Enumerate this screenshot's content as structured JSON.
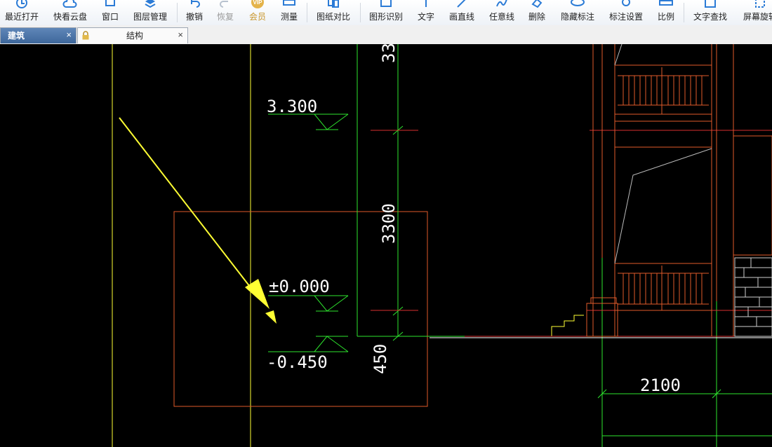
{
  "toolbar": {
    "items": [
      {
        "label": "最近打开",
        "icon": "recent-open-icon"
      },
      {
        "label": "快看云盘",
        "icon": "cloud-disk-icon"
      },
      {
        "label": "窗口",
        "icon": "window-icon"
      },
      {
        "label": "图层管理",
        "icon": "layers-icon"
      },
      {
        "label": "撤销",
        "icon": "undo-icon"
      },
      {
        "label": "恢复",
        "icon": "redo-icon"
      },
      {
        "label": "会员",
        "icon": "vip-icon"
      },
      {
        "label": "测量",
        "icon": "measure-icon"
      },
      {
        "label": "图纸对比",
        "icon": "compare-icon"
      },
      {
        "label": "图形识别",
        "icon": "shape-recognition-icon"
      },
      {
        "label": "文字",
        "icon": "text-icon"
      },
      {
        "label": "画直线",
        "icon": "line-icon"
      },
      {
        "label": "任意线",
        "icon": "freehand-icon"
      },
      {
        "label": "删除",
        "icon": "eraser-icon"
      },
      {
        "label": "隐藏标注",
        "icon": "hide-annotation-icon"
      },
      {
        "label": "标注设置",
        "icon": "annotation-settings-icon"
      },
      {
        "label": "比例",
        "icon": "scale-icon"
      },
      {
        "label": "文字查找",
        "icon": "text-search-icon"
      },
      {
        "label": "屏幕旋转",
        "icon": "rotate-screen-icon"
      }
    ]
  },
  "tabs": [
    {
      "label": "建筑",
      "close": "×",
      "active": true
    },
    {
      "label": "结构",
      "close": "×",
      "active": false,
      "locked": true
    }
  ],
  "drawing": {
    "elevations": [
      "3.300",
      "±0.000",
      "-0.450"
    ],
    "dimensions": [
      "3300",
      "450",
      "2100",
      "33"
    ],
    "colors": {
      "background": "#000000",
      "yellow": "#ffff33",
      "green": "#2ee62e",
      "red": "#d93030",
      "orange": "#e05a2a",
      "white": "#ffffff"
    }
  }
}
